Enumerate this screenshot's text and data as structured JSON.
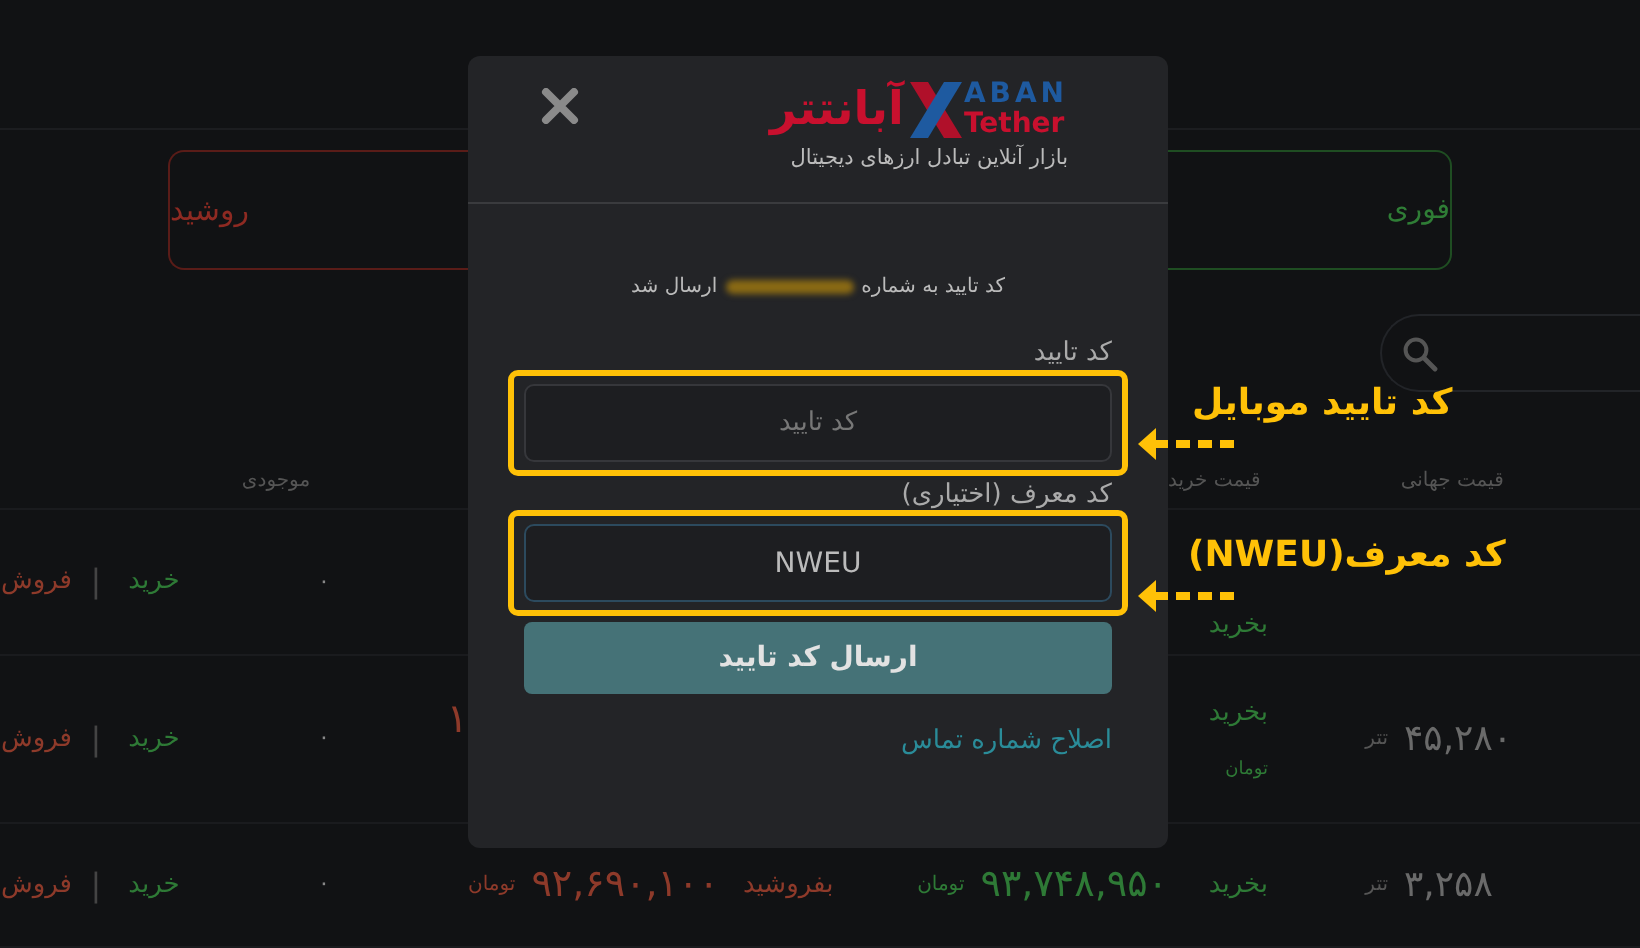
{
  "background": {
    "sell_tab": {
      "label": "روشید"
    },
    "buy_tab": {
      "label": "فوری"
    },
    "columns_left": [
      "موجودی"
    ],
    "columns_right": [
      "قیمت جهانی",
      "قیمت خرید"
    ],
    "rows": [
      {
        "sell": "فروش",
        "separator": "|",
        "buy": "خرید",
        "stock": "۰",
        "buy_label": "بخرید"
      },
      {
        "sell": "فروش",
        "separator": "|",
        "buy": "خرید",
        "stock": "۰",
        "sell_price_fragment": "۱",
        "buy_label": "بخرید",
        "buy_unit": "تومان",
        "global_unit": "تتر",
        "global_price": "۴۵,۲۸۰"
      },
      {
        "sell": "فروش",
        "separator": "|",
        "buy": "خرید",
        "stock": "۰",
        "sell_unit": "تومان",
        "sell_price": "۹۲,۶۹۰,۱۰۰",
        "sell_label": "بفروشید",
        "buy_unit_mid": "تومان",
        "buy_price": "۹۳,۷۴۸,۹۵۰",
        "buy_label": "بخرید",
        "global_unit": "تتر",
        "global_price": "۳,۲۵۸"
      }
    ]
  },
  "modal": {
    "logo": {
      "latin_top": "ABAN",
      "latin_bottom": "Tether",
      "persian": "آبانتتر"
    },
    "tagline": "بازار آنلاین تبادل ارزهای دیجیتال",
    "message_before": "کد تایید به شماره",
    "message_after": "ارسال شد",
    "fields": [
      {
        "label": "کد تایید",
        "placeholder": "کد تایید",
        "focused": false,
        "highlighted": true
      },
      {
        "label": "کد معرف (اختیاری)",
        "value": "NWEU",
        "focused": true,
        "highlighted": true
      }
    ],
    "submit": "ارسال کد تایید",
    "link": "اصلاح شماره تماس"
  },
  "annotations": [
    {
      "text": "کد تایید موبایل"
    },
    {
      "text": "کد معرف(NWEU)"
    }
  ]
}
